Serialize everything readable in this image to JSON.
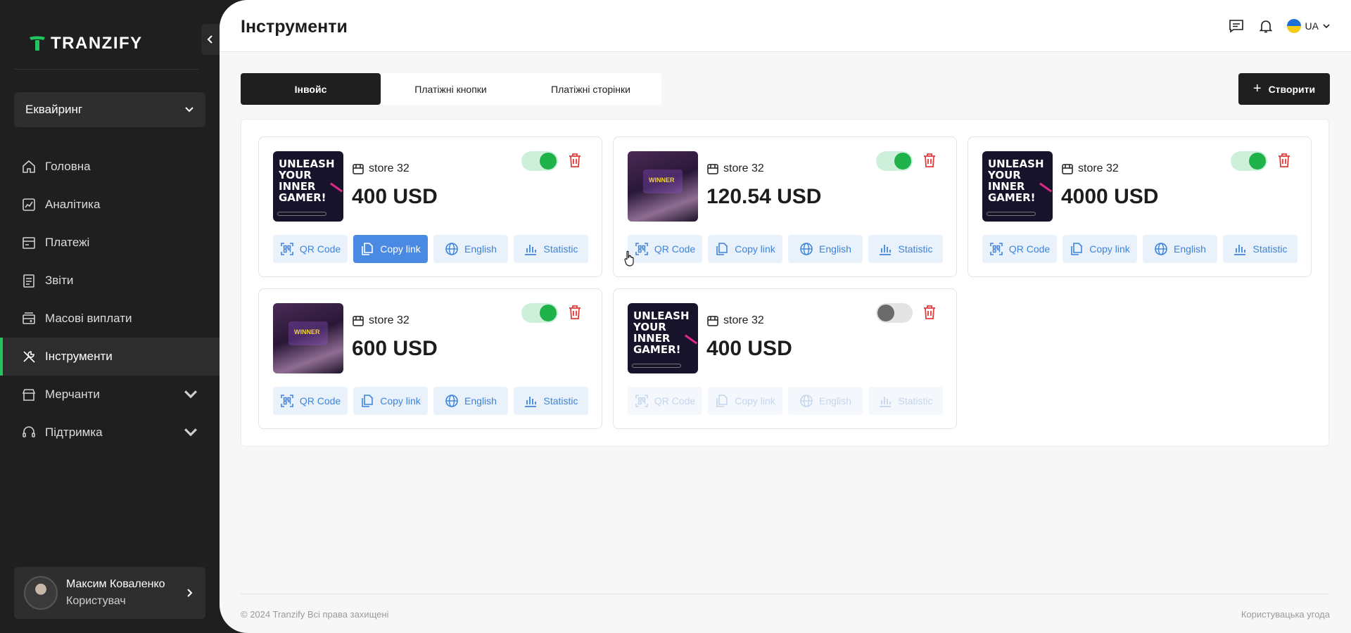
{
  "brand": {
    "name": "TRANZIFY",
    "accent": "#22c55e"
  },
  "sidebar": {
    "selector": {
      "label": "Еквайринг"
    },
    "items": [
      {
        "label": "Головна",
        "icon": "home-icon"
      },
      {
        "label": "Аналітика",
        "icon": "analytics-icon"
      },
      {
        "label": "Платежі",
        "icon": "payments-icon"
      },
      {
        "label": "Звіти",
        "icon": "reports-icon"
      },
      {
        "label": "Масові виплати",
        "icon": "mass-payouts-icon"
      },
      {
        "label": "Інструменти",
        "icon": "tools-icon",
        "active": true
      },
      {
        "label": "Мерчанти",
        "icon": "merchants-icon",
        "expandable": true
      },
      {
        "label": "Підтримка",
        "icon": "support-icon",
        "expandable": true
      }
    ],
    "user": {
      "name": "Максим Коваленко",
      "role": "Користувач"
    }
  },
  "header": {
    "title": "Інструменти",
    "language": "UA"
  },
  "tabs": [
    {
      "label": "Інвойс",
      "active": true
    },
    {
      "label": "Платіжні кнопки"
    },
    {
      "label": "Платіжні сторінки"
    }
  ],
  "create_button": {
    "label": "Створити"
  },
  "action_labels": {
    "qr": "QR Code",
    "copy": "Copy link",
    "lang": "English",
    "stat": "Statistic"
  },
  "cards": [
    {
      "store": "store 32",
      "amount": "400 USD",
      "image": "unleash",
      "enabled": true
    },
    {
      "store": "store 32",
      "amount": "120.54 USD",
      "image": "winner",
      "enabled": true
    },
    {
      "store": "store 32",
      "amount": "4000 USD",
      "image": "unleash",
      "enabled": true
    },
    {
      "store": "store 32",
      "amount": "600 USD",
      "image": "winner",
      "enabled": true
    },
    {
      "store": "store 32",
      "amount": "400 USD",
      "image": "unleash",
      "enabled": false
    }
  ],
  "thumb_text": {
    "unleash": "UNLEASH YOUR INNER GAMER!",
    "winner": "WINNER"
  },
  "footer": {
    "copyright": "© 2024 Tranzify Всі права захищені",
    "agreement": "Користувацька угода"
  }
}
